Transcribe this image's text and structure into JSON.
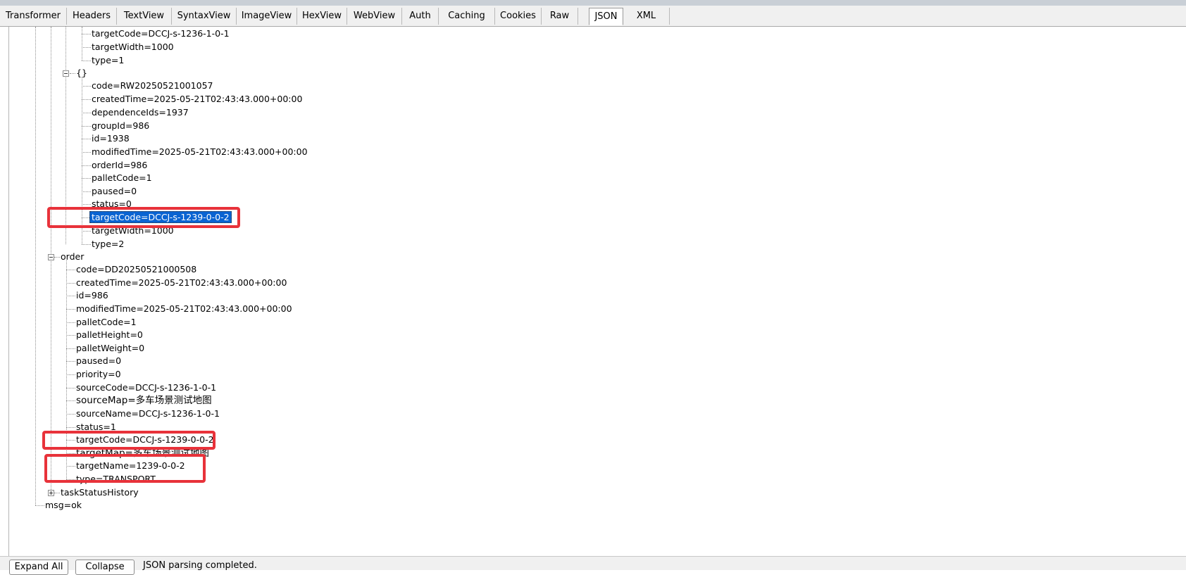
{
  "tabs": [
    "Transformer",
    "Headers",
    "TextView",
    "SyntaxView",
    "ImageView",
    "HexView",
    "WebView",
    "Auth",
    "Caching",
    "Cookies",
    "Raw",
    "JSON",
    "XML"
  ],
  "active_tab": "JSON",
  "tree": {
    "prev_item": [
      "targetCode=DCCJ-s-1236-1-0-1",
      "targetWidth=1000",
      "type=1"
    ],
    "obj_label": "{}",
    "obj_items": [
      "code=RW20250521001057",
      "createdTime=2025-05-21T02:43:43.000+00:00",
      "dependenceIds=1937",
      "groupId=986",
      "id=1938",
      "modifiedTime=2025-05-21T02:43:43.000+00:00",
      "orderId=986",
      "palletCode=1",
      "paused=0",
      "status=0",
      "targetCode=DCCJ-s-1239-0-0-2",
      "targetWidth=1000",
      "type=2"
    ],
    "order_label": "order",
    "order_items": [
      "code=DD20250521000508",
      "createdTime=2025-05-21T02:43:43.000+00:00",
      "id=986",
      "modifiedTime=2025-05-21T02:43:43.000+00:00",
      "palletCode=1",
      "palletHeight=0",
      "palletWeight=0",
      "paused=0",
      "priority=0",
      "sourceCode=DCCJ-s-1236-1-0-1",
      "sourceMap=多车场景测试地图",
      "sourceName=DCCJ-s-1236-1-0-1",
      "status=1",
      "targetCode=DCCJ-s-1239-0-0-2",
      "targetMap=多车场景测试地图",
      "targetName=1239-0-0-2",
      "type=TRANSPORT"
    ],
    "history_label": "taskStatusHistory",
    "msg": "msg=ok"
  },
  "footer": {
    "expand_all": "Expand All",
    "collapse": "Collapse",
    "status": "JSON parsing completed."
  },
  "colors": {
    "selection": "#0a64d2",
    "highlight_box": "#e8323a"
  }
}
